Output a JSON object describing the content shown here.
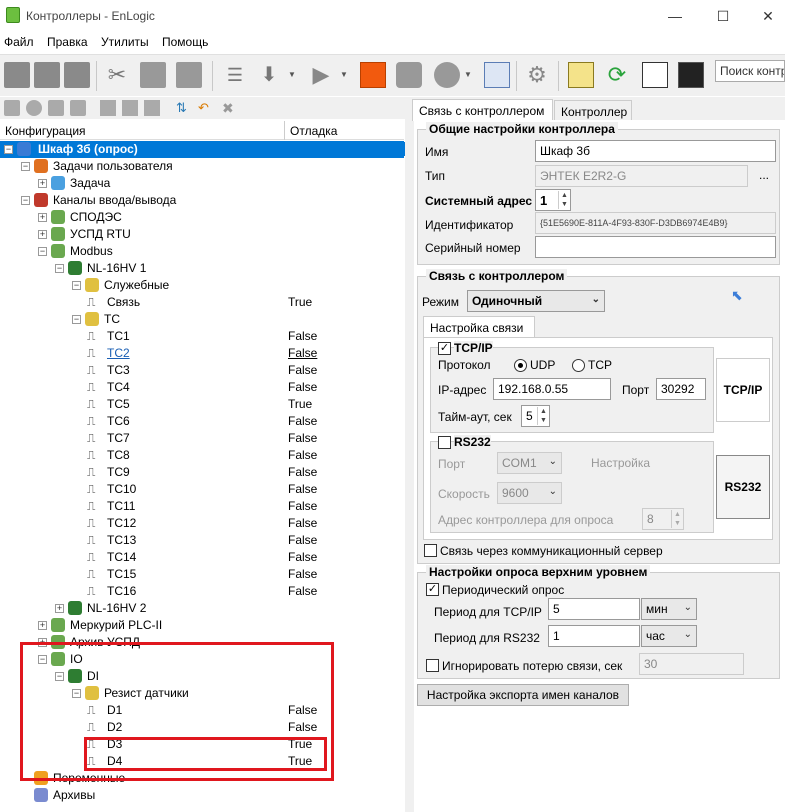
{
  "window": {
    "title": "Контроллеры - EnLogic"
  },
  "menu": [
    "Файл",
    "Правка",
    "Утилиты",
    "Помощь"
  ],
  "toolbar": {
    "search_placeholder": "Поиск контр"
  },
  "tree": {
    "col_config": "Конфигурация",
    "col_debug": "Отладка",
    "rows": [
      {
        "label": "Шкаф 3б (опрос)",
        "value": ""
      },
      {
        "label": "Задачи пользователя",
        "value": ""
      },
      {
        "label": "Задача",
        "value": ""
      },
      {
        "label": "Каналы ввода/вывода",
        "value": ""
      },
      {
        "label": "СПОДЭС",
        "value": ""
      },
      {
        "label": "УСПД RTU",
        "value": ""
      },
      {
        "label": "Modbus",
        "value": ""
      },
      {
        "label": "NL-16HV 1",
        "value": ""
      },
      {
        "label": "Служебные",
        "value": ""
      },
      {
        "label": "Связь",
        "value": "True"
      },
      {
        "label": "ТС",
        "value": ""
      },
      {
        "label": "TC1",
        "value": "False"
      },
      {
        "label": "TC2",
        "value": "False"
      },
      {
        "label": "TC3",
        "value": "False"
      },
      {
        "label": "TC4",
        "value": "False"
      },
      {
        "label": "TC5",
        "value": "True"
      },
      {
        "label": "TC6",
        "value": "False"
      },
      {
        "label": "TC7",
        "value": "False"
      },
      {
        "label": "TC8",
        "value": "False"
      },
      {
        "label": "TC9",
        "value": "False"
      },
      {
        "label": "TC10",
        "value": "False"
      },
      {
        "label": "TC11",
        "value": "False"
      },
      {
        "label": "TC12",
        "value": "False"
      },
      {
        "label": "TC13",
        "value": "False"
      },
      {
        "label": "TC14",
        "value": "False"
      },
      {
        "label": "TC15",
        "value": "False"
      },
      {
        "label": "TC16",
        "value": "False"
      },
      {
        "label": "NL-16HV 2",
        "value": ""
      },
      {
        "label": "Меркурий PLC-II",
        "value": ""
      },
      {
        "label": "Архив УСПД",
        "value": ""
      },
      {
        "label": "IO",
        "value": ""
      },
      {
        "label": "DI",
        "value": ""
      },
      {
        "label": "Резист датчики",
        "value": ""
      },
      {
        "label": "D1",
        "value": "False"
      },
      {
        "label": "D2",
        "value": "False"
      },
      {
        "label": "D3",
        "value": "True"
      },
      {
        "label": "D4",
        "value": "True"
      },
      {
        "label": "Переменные",
        "value": ""
      },
      {
        "label": "Архивы",
        "value": ""
      }
    ]
  },
  "tabs": {
    "conn": "Связь с контроллером",
    "ctrl": "Контроллер"
  },
  "general": {
    "title": "Общие настройки контроллера",
    "name_label": "Имя",
    "name_value": "Шкаф 3б",
    "type_label": "Тип",
    "type_value": "ЭНТЕК E2R2-G",
    "type_btn": "...",
    "sysaddr_label": "Системный адрес",
    "sysaddr_value": "1",
    "id_label": "Идентификатор",
    "id_value": "{51E5690E-811A-4F93-830F-D3DB6974E4B9}",
    "serial_label": "Серийный номер",
    "serial_value": ""
  },
  "connection": {
    "title": "Связь с контроллером",
    "mode_label": "Режим",
    "mode_value": "Одиночный",
    "subtab": "Настройка связи",
    "tcpip_label": "TCP/IP",
    "protocol_label": "Протокол",
    "udp": "UDP",
    "tcp": "TCP",
    "ip_label": "IP-адрес",
    "ip_value": "192.168.0.55",
    "port_label": "Порт",
    "port_value": "30292",
    "timeout_label": "Тайм-аут, сек",
    "timeout_value": "5",
    "rs232_label": "RS232",
    "rs_port_label": "Порт",
    "rs_port_value": "COM1",
    "rs_settings": "Настройка",
    "speed_label": "Скорость",
    "speed_value": "9600",
    "addr_label": "Адрес контроллера для опроса",
    "addr_value": "8",
    "btn_tcpip": "TCP/IP",
    "btn_rs232": "RS232",
    "server_label": "Связь через коммуникационный сервер"
  },
  "polling": {
    "title": "Настройки опроса верхним уровнем",
    "periodic_label": "Периодический опрос",
    "tcp_period_label": "Период для TCP/IP",
    "tcp_period_value": "5",
    "tcp_unit": "мин",
    "rs_period_label": "Период для RS232",
    "rs_period_value": "1",
    "rs_unit": "час",
    "ignore_label": "Игнорировать потерю связи, сек",
    "ignore_value": "30"
  },
  "export_btn": "Настройка экспорта имен каналов"
}
